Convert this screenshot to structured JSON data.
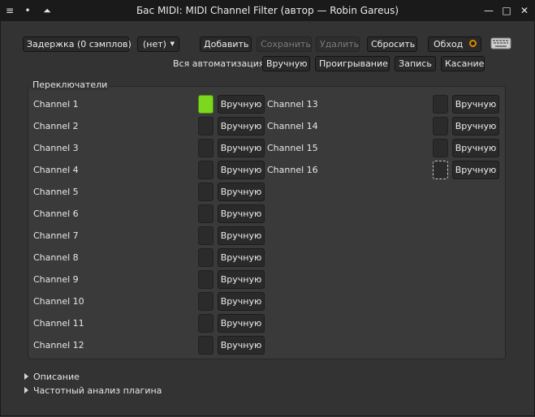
{
  "window": {
    "title": "Бас MIDI: MIDI Channel Filter (автор — Robin Gareus)",
    "menu_icon": "≡",
    "pin_icon": "•",
    "keep_above_icon": "⏶",
    "minimize_icon": "—",
    "maximize_icon": "□",
    "close_icon": "✕"
  },
  "toolbar": {
    "latency_label": "Задержка (0 сэмплов)",
    "preset_value": "(нет)",
    "add_label": "Добавить",
    "save_label": "Сохранить",
    "delete_label": "Удалить",
    "reset_label": "Сбросить",
    "bypass_label": "Обход",
    "keyboard_icon": "keyboard-icon"
  },
  "automation": {
    "label": "Вся автоматизация",
    "manual": "Вручную",
    "play": "Проигрывание",
    "write": "Запись",
    "touch": "Касание"
  },
  "switches": {
    "title": "Переключатели",
    "mode_label": "Вручную",
    "channels": [
      {
        "name": "Channel  1",
        "on": true
      },
      {
        "name": "Channel  2",
        "on": false
      },
      {
        "name": "Channel  3",
        "on": false
      },
      {
        "name": "Channel  4",
        "on": false
      },
      {
        "name": "Channel  5",
        "on": false
      },
      {
        "name": "Channel  6",
        "on": false
      },
      {
        "name": "Channel  7",
        "on": false
      },
      {
        "name": "Channel  8",
        "on": false
      },
      {
        "name": "Channel  9",
        "on": false
      },
      {
        "name": "Channel 10",
        "on": false
      },
      {
        "name": "Channel 11",
        "on": false
      },
      {
        "name": "Channel 12",
        "on": false
      },
      {
        "name": "Channel 13",
        "on": false
      },
      {
        "name": "Channel 14",
        "on": false
      },
      {
        "name": "Channel 15",
        "on": false
      },
      {
        "name": "Channel 16",
        "on": false
      }
    ]
  },
  "expanders": {
    "description": "Описание",
    "analysis": "Частотный анализ плагина"
  },
  "colors": {
    "active_toggle": "#7bd81e",
    "background": "#333333",
    "titlebar": "#1a1a1a"
  }
}
